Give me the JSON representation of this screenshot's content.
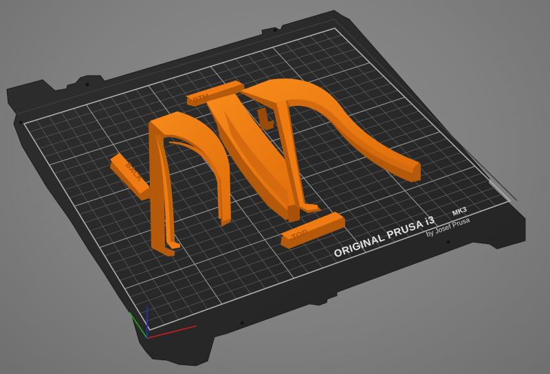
{
  "bed": {
    "brand_line1": "ORIGINAL PRUSA i3",
    "brand_model": "MK3",
    "brand_line2": "by Josef Prusa"
  },
  "parts": {
    "label_top": "TOP",
    "label_back": "BACK",
    "label_btm": "BTM"
  },
  "axes": {
    "x_color": "#c81e1e",
    "y_color": "#1ea81e",
    "z_color": "#2233cc"
  },
  "colors": {
    "background": "#808080",
    "bed_plate": "#2a2a2a",
    "grid_line": "#6a6a6a",
    "grid_major": "#9a9a9a",
    "part_filament": "#f07b12",
    "part_shadow": "#b45a0a"
  }
}
